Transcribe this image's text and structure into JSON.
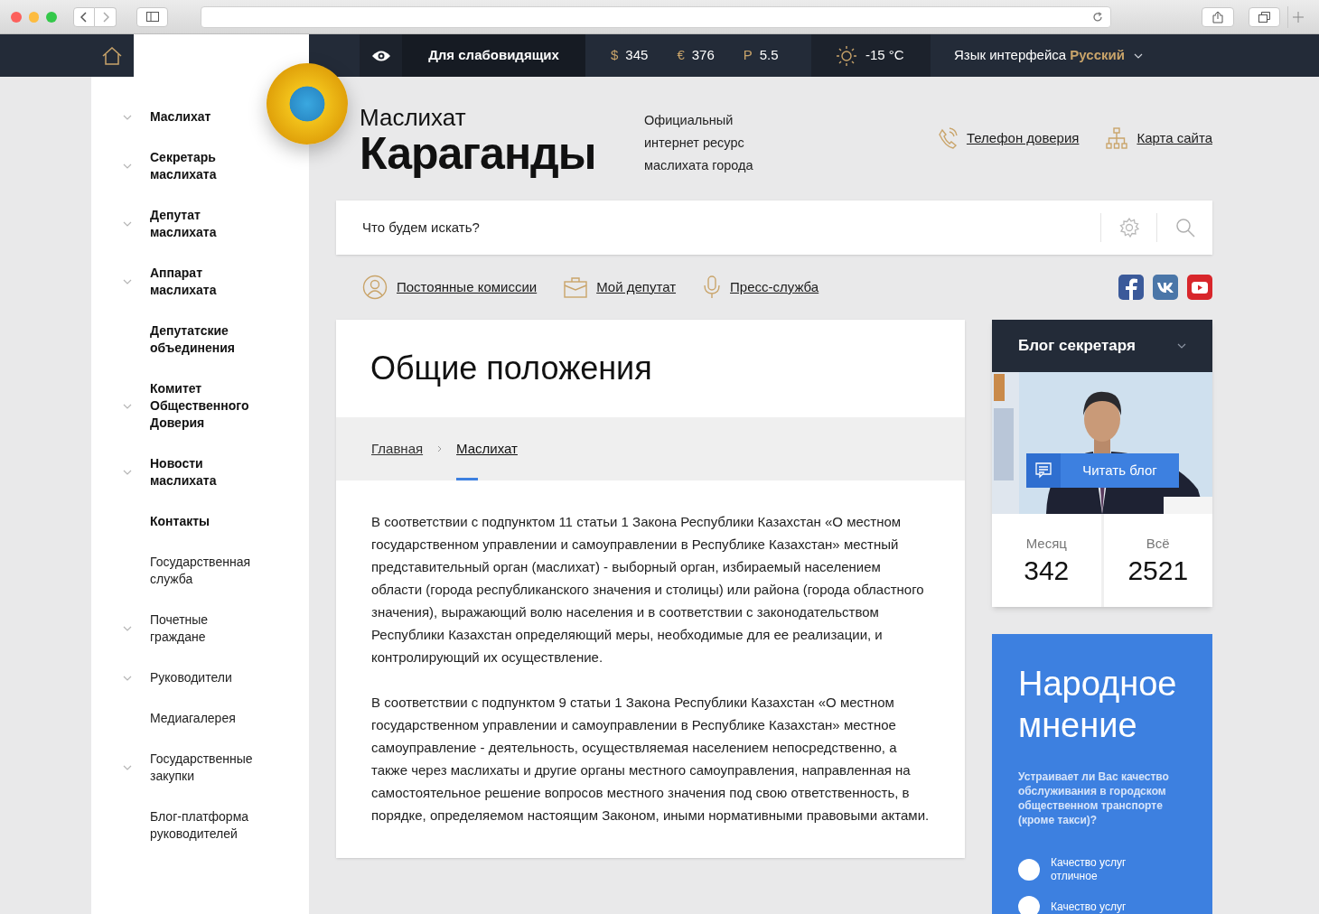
{
  "topbar": {
    "accessibility": "Для слабовидящих",
    "currencies": [
      {
        "symbol": "$",
        "value": "345"
      },
      {
        "symbol": "€",
        "value": "376"
      },
      {
        "symbol": "Р",
        "value": "5.5"
      }
    ],
    "weather": "-15 °C",
    "language_label": "Язык интерфейса",
    "language_value": "Русский"
  },
  "header": {
    "title_small": "Маслихат",
    "title_big": "Караганды",
    "tagline": "Официальный интернет ресурс маслихата города",
    "links": [
      {
        "kind": "phone",
        "label": "Телефон доверия"
      },
      {
        "kind": "sitemap",
        "label": "Карта сайта"
      }
    ]
  },
  "search": {
    "placeholder": "Что будем искать?"
  },
  "quick_links": [
    {
      "kind": "person",
      "label": "Постоянные комиссии"
    },
    {
      "kind": "briefcase",
      "label": "Мой депутат"
    },
    {
      "kind": "microphone",
      "label": "Пресс-служба"
    }
  ],
  "sidebar": {
    "items": [
      {
        "label": "Маслихат",
        "kind": "primary",
        "expandable": true
      },
      {
        "label": "Секретарь маслихата",
        "kind": "primary",
        "expandable": true
      },
      {
        "label": "Депутат маслихата",
        "kind": "primary",
        "expandable": true
      },
      {
        "label": "Аппарат маслихата",
        "kind": "primary",
        "expandable": true
      },
      {
        "label": "Депутатские объединения",
        "kind": "primary",
        "expandable": false
      },
      {
        "label": "Комитет Общественного Доверия",
        "kind": "primary",
        "expandable": true
      },
      {
        "label": "Новости маслихата",
        "kind": "primary",
        "expandable": true
      },
      {
        "label": "Контакты",
        "kind": "primary",
        "expandable": false
      },
      {
        "label": "Государственная служба",
        "kind": "secondary",
        "expandable": false
      },
      {
        "label": "Почетные граждане",
        "kind": "secondary",
        "expandable": true
      },
      {
        "label": "Руководители",
        "kind": "secondary",
        "expandable": true
      },
      {
        "label": "Медиагалерея",
        "kind": "secondary",
        "expandable": false
      },
      {
        "label": "Государственные закупки",
        "kind": "secondary",
        "expandable": true
      },
      {
        "label": "Блог-платформа руководителей",
        "kind": "secondary",
        "expandable": false
      }
    ]
  },
  "article": {
    "title": "Общие положения",
    "breadcrumbs": [
      {
        "label": "Главная",
        "selected": false
      },
      {
        "label": "Маслихат",
        "selected": true
      }
    ],
    "paragraphs": [
      "В соответствии с подпунктом 11 статьи 1 Закона Республики Казахстан «О местном государственном управлении и самоуправлении в Республике Казахстан» местный представительный орган (маслихат) - выборный орган, избираемый населением области (города республиканского значения и столицы) или района (города областного значения), выражающий волю населения и в соответствии с законодательством Республики Казахстан определяющий меры, необходимые для ее реализации, и контролирующий их осуществление.",
      "В соответствии с подпунктом 9 статьи 1 Закона Республики Казахстан «О местном государственном управлении и самоуправлении в Республике Казахстан» местное самоуправление - деятельность, осуществляемая населением непосредственно, а также через маслихаты и другие органы местного самоуправления, направленная на самостоятельное решение вопросов местного значения под свою ответственность, в порядке, определяемом настоящим Законом, иными нормативными правовыми актами."
    ]
  },
  "blog": {
    "title": "Блог секретаря",
    "button": "Читать блог",
    "stats": [
      {
        "label": "Месяц",
        "value": "342"
      },
      {
        "label": "Всё",
        "value": "2521"
      }
    ]
  },
  "poll": {
    "title": "Народное мнение",
    "question": "Устраивает ли Вас качество обслуживания в городском общественном транспорте (кроме такси)?",
    "options": [
      {
        "label": "Качество услуг отличное",
        "selected": false
      },
      {
        "label": "Качество услуг",
        "selected": false
      }
    ]
  }
}
